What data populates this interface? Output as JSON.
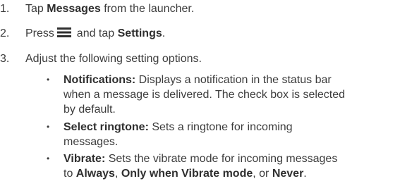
{
  "steps": [
    {
      "number": "1.",
      "pre": "Tap ",
      "bold": "Messages",
      "post": " from the launcher."
    },
    {
      "number": "2.",
      "pre": "Press ",
      "icon": "menu-icon",
      "mid": " and tap ",
      "bold": "Settings",
      "post": "."
    },
    {
      "number": "3.",
      "text": "Adjust the following setting options."
    }
  ],
  "bullets": [
    {
      "title": "Notifications:",
      "line1": " Displays a notification in the status bar",
      "line2": "when a message is delivered. The check box is selected",
      "line3": "by default."
    },
    {
      "title": "Select ringtone:",
      "line1": " Sets a ringtone for incoming",
      "line2": "messages."
    },
    {
      "title": "Vibrate:",
      "line1": " Sets the vibrate mode for incoming messages",
      "line2_pre": "to ",
      "opt1": "Always",
      "sep1": ", ",
      "opt2": "Only when Vibrate mode",
      "sep2": ", or ",
      "opt3": "Never",
      "end": "."
    }
  ],
  "bullet_glyph": "•"
}
